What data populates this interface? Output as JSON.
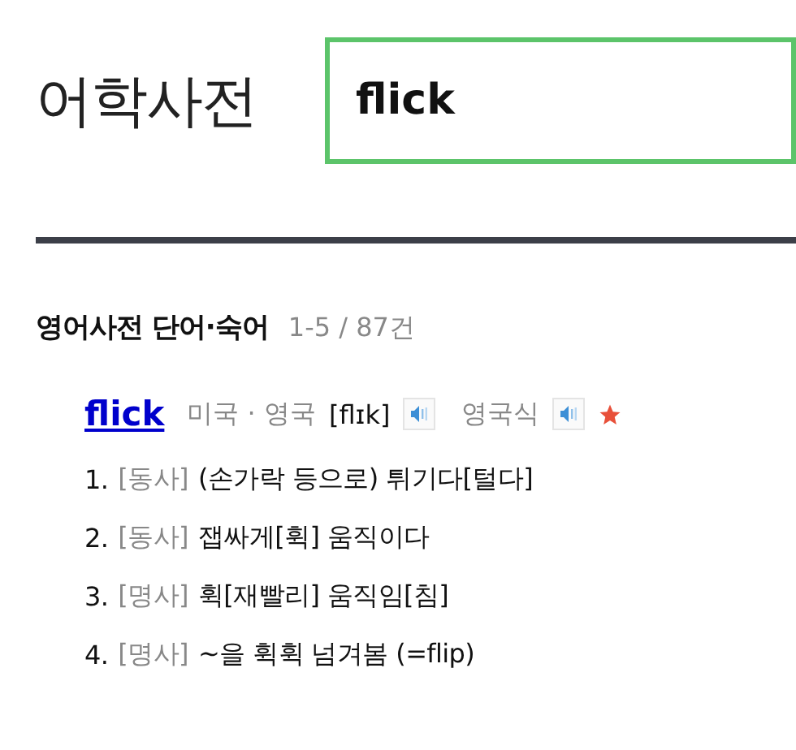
{
  "logo": "어학사전",
  "search": {
    "value": "flick"
  },
  "section": {
    "title": "영어사전 단어·숙어",
    "count": "1-5 / 87건"
  },
  "entry": {
    "word": "flick",
    "region": "미국 · 영국",
    "pronunciation": "[flɪk]",
    "alt_region": "영국식",
    "definitions": [
      {
        "number": "1.",
        "pos": "[동사]",
        "text": "(손가락 등으로) 튀기다[털다]"
      },
      {
        "number": "2.",
        "pos": "[동사]",
        "text": "잽싸게[휙] 움직이다"
      },
      {
        "number": "3.",
        "pos": "[명사]",
        "text": "휙[재빨리] 움직임[침]"
      },
      {
        "number": "4.",
        "pos": "[명사]",
        "text": "~을 휙휙 넘겨봄 (=flip)"
      }
    ]
  }
}
